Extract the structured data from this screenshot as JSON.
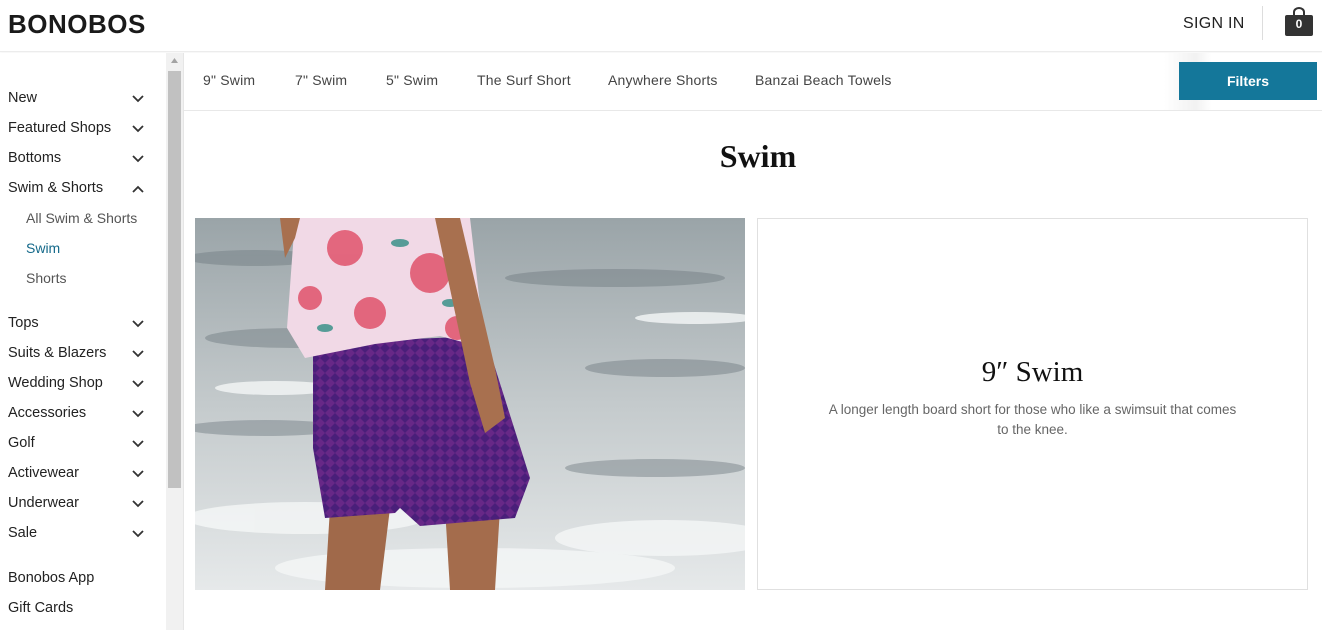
{
  "header": {
    "logo": "BONOBOS",
    "sign_in": "SIGN IN",
    "cart_count": "0"
  },
  "sidebar": {
    "items": [
      {
        "label": "New",
        "chevron": "chevron-down-icon"
      },
      {
        "label": "Featured Shops",
        "chevron": "chevron-down-icon"
      },
      {
        "label": "Bottoms",
        "chevron": "chevron-down-icon"
      },
      {
        "label": "Swim & Shorts",
        "chevron": "chevron-up-icon",
        "expanded": true
      },
      {
        "label": "Tops",
        "chevron": "chevron-down-icon"
      },
      {
        "label": "Suits & Blazers",
        "chevron": "chevron-down-icon"
      },
      {
        "label": "Wedding Shop",
        "chevron": "chevron-down-icon"
      },
      {
        "label": "Accessories",
        "chevron": "chevron-down-icon"
      },
      {
        "label": "Golf",
        "chevron": "chevron-down-icon"
      },
      {
        "label": "Activewear",
        "chevron": "chevron-down-icon"
      },
      {
        "label": "Underwear",
        "chevron": "chevron-down-icon"
      },
      {
        "label": "Sale",
        "chevron": "chevron-down-icon"
      }
    ],
    "sub_items": [
      {
        "label": "All Swim & Shorts"
      },
      {
        "label": "Swim",
        "active": true
      },
      {
        "label": "Shorts"
      }
    ],
    "extras": [
      {
        "label": "Bonobos App"
      },
      {
        "label": "Gift Cards"
      }
    ]
  },
  "subnav": {
    "links": [
      "9\" Swim",
      "7\" Swim",
      "5\" Swim",
      "The Surf Short",
      "Anywhere Shorts",
      "Banzai Beach Towels"
    ],
    "filters_label": "Filters"
  },
  "main": {
    "title": "Swim",
    "card": {
      "title": "9″ Swim",
      "description": "A longer length board short for those who like a swimsuit that comes to the knee."
    }
  },
  "colors": {
    "accent": "#14779a",
    "active_link": "#14698a"
  }
}
